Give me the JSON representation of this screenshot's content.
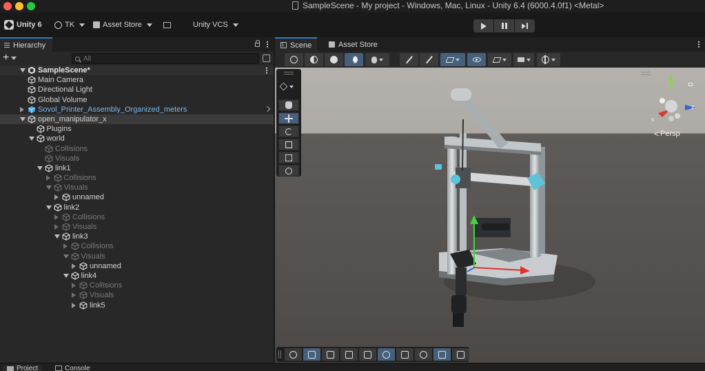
{
  "window": {
    "title": "SampleScene - My project - Windows, Mac, Linux - Unity 6.4 (6000.4.0f1) <Metal>"
  },
  "toolbar": {
    "app_label": "Unity 6",
    "account_label": "TK",
    "asset_store_label": "Asset Store",
    "vcs_label": "Unity VCS"
  },
  "hierarchy": {
    "tab_label": "Hierarchy",
    "search_placeholder": "All",
    "scene_label": "SampleScene*",
    "items": [
      {
        "label": "Main Camera",
        "depth": 1,
        "expander": "none",
        "style": "normal"
      },
      {
        "label": "Directional Light",
        "depth": 1,
        "expander": "none",
        "style": "normal"
      },
      {
        "label": "Global Volume",
        "depth": 1,
        "expander": "none",
        "style": "normal"
      },
      {
        "label": "Sovol_Printer_Assembly_Organized_meters",
        "depth": 1,
        "expander": "collapsed",
        "style": "prefab"
      },
      {
        "label": "open_manipulator_x",
        "depth": 1,
        "expander": "expanded",
        "style": "selected"
      },
      {
        "label": "Plugins",
        "depth": 2,
        "expander": "none",
        "style": "normal"
      },
      {
        "label": "world",
        "depth": 2,
        "expander": "expanded",
        "style": "normal"
      },
      {
        "label": "Collisions",
        "depth": 3,
        "expander": "none",
        "style": "dim"
      },
      {
        "label": "Visuals",
        "depth": 3,
        "expander": "none",
        "style": "dim"
      },
      {
        "label": "link1",
        "depth": 3,
        "expander": "expanded",
        "style": "normal"
      },
      {
        "label": "Collisions",
        "depth": 4,
        "expander": "collapsed",
        "style": "dim"
      },
      {
        "label": "Visuals",
        "depth": 4,
        "expander": "expanded",
        "style": "dim"
      },
      {
        "label": "unnamed",
        "depth": 5,
        "expander": "collapsed",
        "style": "normal"
      },
      {
        "label": "link2",
        "depth": 4,
        "expander": "expanded",
        "style": "normal"
      },
      {
        "label": "Collisions",
        "depth": 5,
        "expander": "collapsed",
        "style": "dim"
      },
      {
        "label": "Visuals",
        "depth": 5,
        "expander": "collapsed",
        "style": "dim"
      },
      {
        "label": "link3",
        "depth": 5,
        "expander": "expanded",
        "style": "normal"
      },
      {
        "label": "Collisions",
        "depth": 6,
        "expander": "collapsed",
        "style": "dim"
      },
      {
        "label": "Visuals",
        "depth": 6,
        "expander": "expanded",
        "style": "dim"
      },
      {
        "label": "unnamed",
        "depth": 7,
        "expander": "collapsed",
        "style": "normal"
      },
      {
        "label": "link4",
        "depth": 6,
        "expander": "expanded",
        "style": "normal"
      },
      {
        "label": "Collisions",
        "depth": 7,
        "expander": "collapsed",
        "style": "dim"
      },
      {
        "label": "Visuals",
        "depth": 7,
        "expander": "collapsed",
        "style": "dim"
      },
      {
        "label": "link5",
        "depth": 7,
        "expander": "collapsed",
        "style": "normal"
      }
    ]
  },
  "scene_view": {
    "tabs": [
      {
        "label": "Scene",
        "icon": "grid-icon",
        "active": true
      },
      {
        "label": "Asset Store",
        "icon": "asset-store-icon",
        "active": false
      }
    ],
    "projection_label": "Persp",
    "axis_labels": {
      "y": "y",
      "z": "z",
      "x": "x"
    }
  },
  "footer": {
    "tabs": [
      "Project",
      "Console"
    ]
  },
  "colors": {
    "accent": "#3a79bb",
    "active_button": "#46607c",
    "prefab_text": "#7ab8ec",
    "panel_bg": "#282828"
  }
}
